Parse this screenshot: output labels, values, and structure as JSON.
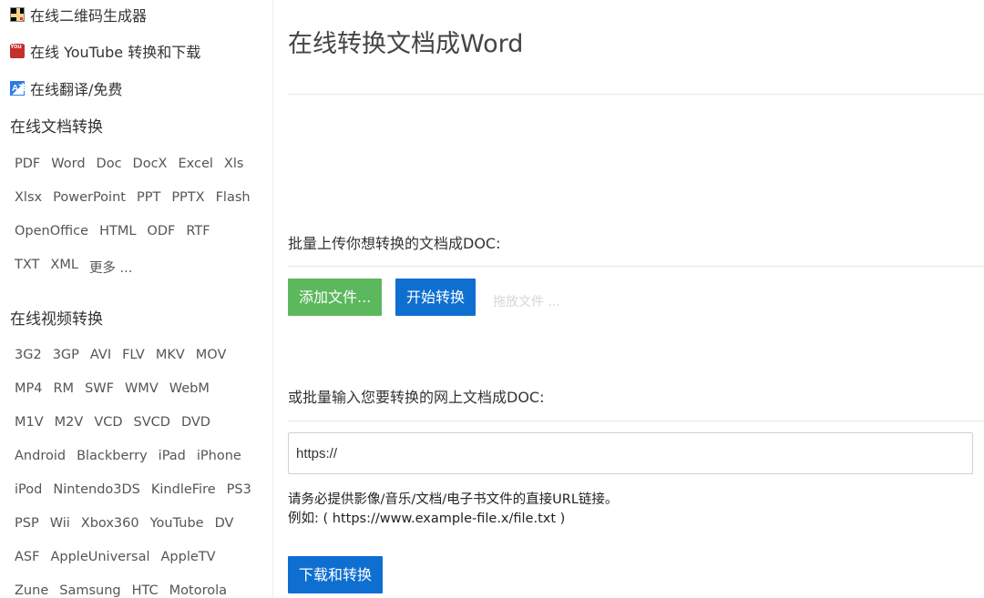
{
  "sidebar": {
    "tools": [
      {
        "icon": "qr-code-icon",
        "label": "在线二维码生成器"
      },
      {
        "icon": "youtube-icon",
        "icon_text": "You Tube",
        "label": "在线 YouTube 转换和下载"
      },
      {
        "icon": "translate-icon",
        "icon_text": "A文",
        "label": "在线翻译/免费"
      }
    ],
    "doc_section": {
      "title": "在线文档转换",
      "rows": [
        [
          "PDF",
          "Word",
          "Doc",
          "DocX",
          "Excel",
          "Xls"
        ],
        [
          "Xlsx",
          "PowerPoint",
          "PPT",
          "PPTX",
          "Flash"
        ],
        [
          "OpenOffice",
          "HTML",
          "ODF",
          "RTF"
        ],
        [
          "TXT",
          "XML",
          "更多 ..."
        ]
      ]
    },
    "video_section": {
      "title": "在线视频转换",
      "rows": [
        [
          "3G2",
          "3GP",
          "AVI",
          "FLV",
          "MKV",
          "MOV"
        ],
        [
          "MP4",
          "RM",
          "SWF",
          "WMV",
          "WebM"
        ],
        [
          "M1V",
          "M2V",
          "VCD",
          "SVCD",
          "DVD"
        ],
        [
          "Android",
          "Blackberry",
          "iPad",
          "iPhone"
        ],
        [
          "iPod",
          "Nintendo3DS",
          "KindleFire",
          "PS3"
        ],
        [
          "PSP",
          "Wii",
          "Xbox360",
          "YouTube",
          "DV"
        ],
        [
          "ASF",
          "AppleUniversal",
          "AppleTV"
        ],
        [
          "Zune",
          "Samsung",
          "HTC",
          "Motorola"
        ]
      ]
    }
  },
  "main": {
    "title": "在线转换文档成Word",
    "upload_label": "批量上传你想转换的文档成DOC:",
    "add_files_button": "添加文件...",
    "start_convert_button": "开始转换",
    "drop_hint": "拖放文件 ...",
    "url_label": "或批量输入您要转换的网上文档成DOC:",
    "url_input_value": "https://",
    "url_hint_line1": "请务必提供影像/音乐/文档/电子书文件的直接URL链接。",
    "url_hint_line2": "例如: ( https://www.example-file.x/file.txt )",
    "download_convert_button": "下载和转换"
  },
  "colors": {
    "green_button": "#5cb85c",
    "blue_button": "#0e6fd1"
  }
}
